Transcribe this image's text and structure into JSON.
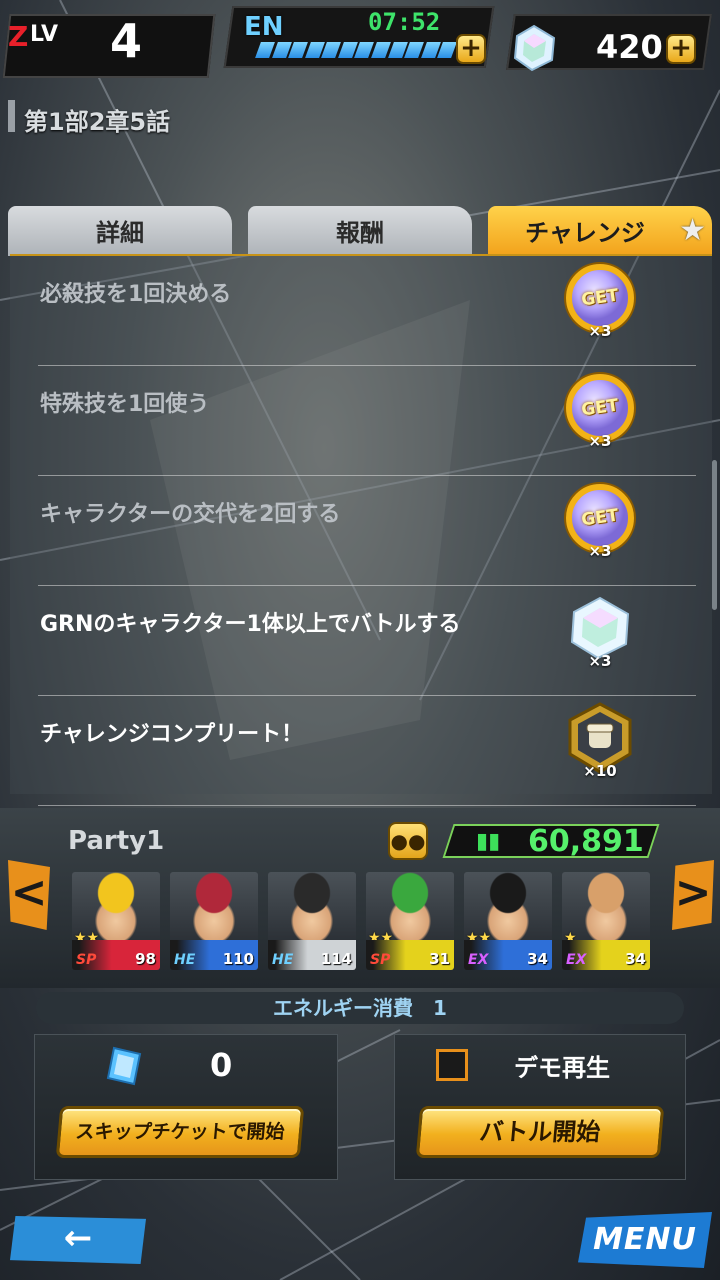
{
  "header": {
    "level_prefix": "Z",
    "level_label": "LV",
    "level": "4",
    "energy_label": "EN",
    "energy_timer": "07:52",
    "energy_plus": "+",
    "gem_count": "420",
    "gem_plus": "+"
  },
  "chapter": "第1部2章5話",
  "tabs": [
    {
      "label": "詳細",
      "active": false
    },
    {
      "label": "報酬",
      "active": false
    },
    {
      "label": "チャレンジ",
      "active": true
    }
  ],
  "tab_star": "★",
  "challenges": [
    {
      "text": "必殺技を1回決める",
      "reward": "get-coin",
      "reward_label": "GET",
      "amount": "×3",
      "completed": true
    },
    {
      "text": "特殊技を1回使う",
      "reward": "get-coin",
      "reward_label": "GET",
      "amount": "×3",
      "completed": true
    },
    {
      "text": "キャラクターの交代を2回する",
      "reward": "get-coin",
      "reward_label": "GET",
      "amount": "×3",
      "completed": true
    },
    {
      "text": "GRNのキャラクター1体以上でバトルする",
      "reward": "chrono-crystal",
      "amount": "×3",
      "completed": false
    },
    {
      "text": "チャレンジコンプリート！",
      "reward": "fist-medal",
      "amount": "×10",
      "completed": false
    }
  ],
  "party": {
    "name": "Party1",
    "power": "60,891",
    "prev_arrow": "<",
    "next_arrow": ">",
    "members": [
      {
        "name": "super-saiyan-gohan",
        "stars": "★★",
        "rarity": "SP",
        "level": "98",
        "band_color": "#d8253a",
        "hair": "#f2c51e"
      },
      {
        "name": "vegeta",
        "stars": "",
        "rarity": "HE",
        "level": "110",
        "band_color": "#2e6fd8",
        "hair": "#b0283a"
      },
      {
        "name": "shallot",
        "stars": "",
        "rarity": "HE",
        "level": "114",
        "band_color": "#cfd3d6",
        "hair": "#2a2a2a"
      },
      {
        "name": "piccolo",
        "stars": "★★",
        "rarity": "SP",
        "level": "31",
        "band_color": "#e4d21c",
        "hair": "#3aa83e"
      },
      {
        "name": "goku",
        "stars": "★★",
        "rarity": "EX",
        "level": "34",
        "band_color": "#2e6fd8",
        "hair": "#1a1a1a"
      },
      {
        "name": "nappa",
        "stars": "★",
        "rarity": "EX",
        "level": "34",
        "band_color": "#e4d21c",
        "hair": "#d8a06a"
      }
    ]
  },
  "energy_cost_label": "エネルギー消費　1",
  "skip_ticket_count": "0",
  "demo_label": "デモ再生",
  "skip_button_label": "スキップチケットで開始",
  "battle_button_label": "バトル開始",
  "back_icon": "←",
  "menu_label": "MENU",
  "colors": {
    "accent": "#f2a21b",
    "power_green": "#56f06b",
    "energy_blue": "#2a8fe6"
  }
}
